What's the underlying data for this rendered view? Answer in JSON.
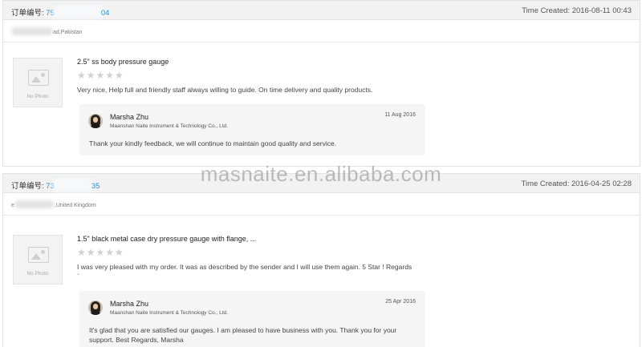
{
  "orders": [
    {
      "order_label": "订单编号:",
      "order_prefix": "75",
      "order_suffix": "04",
      "time_created": "Time Created: 2016-08-11 00:43",
      "buyer_location": "ad,Pakistan",
      "no_photo": "No Photo",
      "product_title": "2.5\" ss body pressure gauge",
      "stars": "★★★★★",
      "feedback": "Very nice, Help full and friendly staff always willing to guide. On time delivery and quality products.",
      "reply": {
        "name": "Marsha Zhu",
        "company": "Maanshan Naite Instrument & Technology Co., Ltd.",
        "date": "11 Aug 2016",
        "text": "Thank your kindly feedback,  we will continue to maintain good quality and service."
      }
    },
    {
      "order_label": "订单编号:",
      "order_prefix": "73",
      "order_suffix": "35",
      "time_created": "Time Created: 2016-04-25 02:28",
      "buyer_location": ",United Kingdom",
      "buyer_prefix": "e",
      "no_photo": "No Photo",
      "product_title": "1.5\" black metal case dry pressure gauge with flange, ...",
      "stars": "★★★★★",
      "feedback": "I was very pleased with my order. It was as described by the sender and I will use them again. 5 Star ! Regards `",
      "reply": {
        "name": "Marsha Zhu",
        "company": "Maanshan Naite Instrument & Technology Co., Ltd.",
        "date": "25 Apr 2016",
        "text": "It's glad that you are satisfied our gauges. I am pleased to have business with you.  Thank you for your support.   Best Regards, Marsha"
      }
    }
  ],
  "watermark": "masnaite.en.alibaba.com"
}
